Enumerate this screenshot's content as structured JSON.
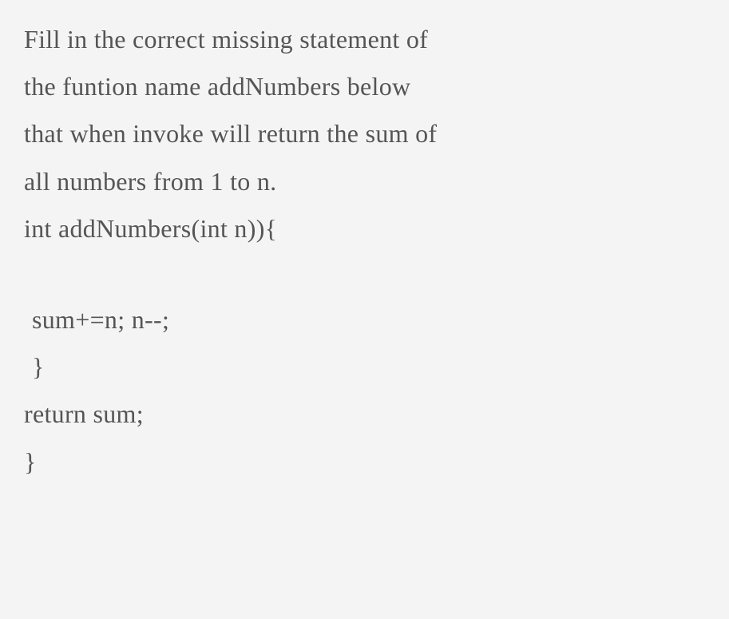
{
  "question": {
    "line1": "Fill in the correct missing statement of",
    "line2": "the funtion name addNumbers below",
    "line3": "that when invoke will return the sum of",
    "line4": "all numbers from 1 to n.",
    "line5": "int addNumbers(int n)){"
  },
  "code": {
    "line1": "sum+=n; n--;",
    "line2": "}",
    "line3": "return sum;",
    "line4": "}"
  }
}
